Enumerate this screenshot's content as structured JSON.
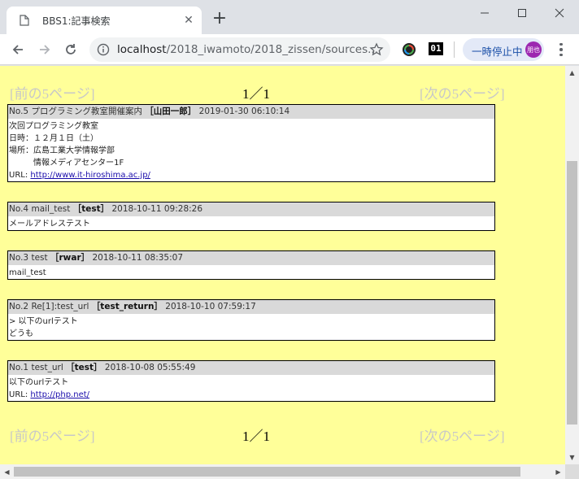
{
  "browser": {
    "tab_title": "BBS1:記事検索",
    "tab_close": "✕",
    "new_tab": "+",
    "url_host": "localhost",
    "url_path": "/2018_iwamoto/2018_zissen/sources...",
    "extension_01": "01",
    "pause_label": "一時停止中",
    "avatar_label": "朋也",
    "icons": {
      "favicon": "document-icon",
      "back": "back-arrow-icon",
      "forward": "forward-arrow-icon",
      "reload": "reload-icon",
      "info": "info-icon",
      "star": "star-icon"
    }
  },
  "pager_top": {
    "prev": "[前の5ページ]",
    "pages": "1／1",
    "next": "[次の5ページ]"
  },
  "posts": [
    {
      "no": "No.5",
      "subject": "プログラミング教室開催案内",
      "author": "［山田一郎］",
      "date": "2019-01-30 06:10:14",
      "lines": [
        "次回プログラミング教室",
        "日時：１２月１日（土）",
        "場所：広島工業大学情報学部",
        "　　　情報メディアセンター1F"
      ],
      "url_label": "URL: ",
      "url": "http://www.it-hiroshima.ac.jp/"
    },
    {
      "no": "No.4",
      "subject": "mail_test",
      "author": "［test］",
      "date": "2018-10-11 09:28:26",
      "lines": [
        "メールアドレステスト"
      ]
    },
    {
      "no": "No.3",
      "subject": "test",
      "author": "［rwar］",
      "date": "2018-10-11 08:35:07",
      "lines": [
        "mail_test"
      ]
    },
    {
      "no": "No.2",
      "subject": "Re[1]:test_url",
      "author": "［test_return］",
      "date": "2018-10-10 07:59:17",
      "lines": [
        "> 以下のurlテスト",
        "どうも"
      ]
    },
    {
      "no": "No.1",
      "subject": "test_url",
      "author": "［test］",
      "date": "2018-10-08 05:55:49",
      "lines": [
        "以下のurlテスト"
      ],
      "url_label": "URL: ",
      "url": "http://php.net/"
    }
  ],
  "pager_bottom": {
    "prev": "[前の5ページ]",
    "pages": "1／1",
    "next": "[次の5ページ]"
  },
  "colors": {
    "page_bg": "#ffff99",
    "post_header_bg": "#d9d9d9",
    "link": "#1a0dab",
    "pager_disabled": "#c8c8c8"
  }
}
